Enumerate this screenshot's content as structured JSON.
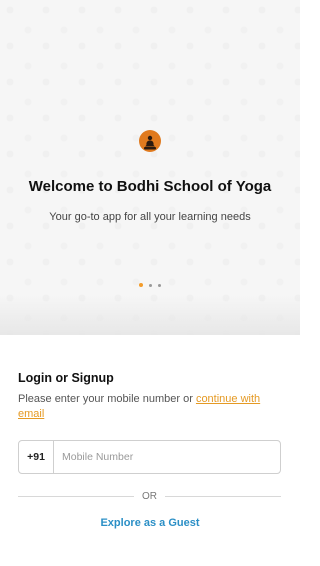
{
  "onboarding": {
    "logo_icon": "yoga-meditation-logo-icon",
    "welcome_title": "Welcome to Bodhi School of Yoga",
    "tagline": "Your go-to app for all your learning needs",
    "carousel": {
      "total_slides": 3,
      "active_index": 0
    }
  },
  "login": {
    "title": "Login or Signup",
    "description_prefix": "Please enter your mobile number or ",
    "email_link": "continue with email",
    "country_code": "+91",
    "mobile_placeholder": "Mobile Number",
    "mobile_value": "",
    "divider_text": "OR",
    "guest_label": "Explore as a Guest"
  },
  "colors": {
    "accent_orange": "#f39c2b",
    "link_orange": "#e59a24",
    "guest_blue": "#2b8fc6"
  }
}
